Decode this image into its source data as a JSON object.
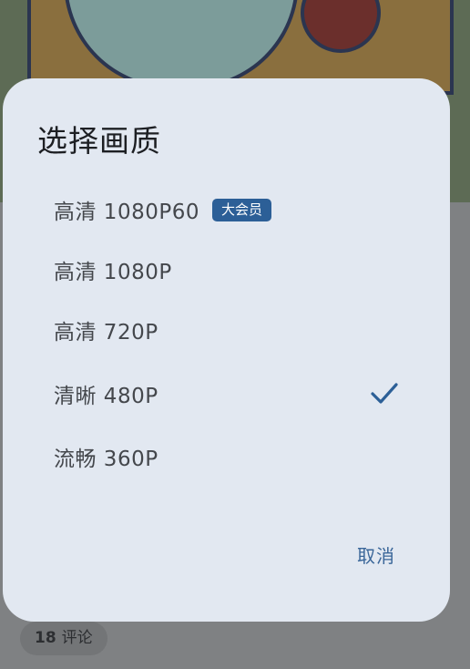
{
  "dialog": {
    "title": "选择画质",
    "options": [
      {
        "label": "高清 1080P60",
        "badge": "大会员",
        "selected": false
      },
      {
        "label": "高清 1080P",
        "selected": false
      },
      {
        "label": "高清 720P",
        "selected": false
      },
      {
        "label": "清晰 480P",
        "selected": true
      },
      {
        "label": "流畅 360P",
        "selected": false
      }
    ],
    "cancel_label": "取消",
    "check_icon": "check-icon",
    "accent_color": "#2c5f97",
    "background_color": "#e2e8f1"
  },
  "background": {
    "comment_count": "18",
    "comment_label": "评论"
  }
}
